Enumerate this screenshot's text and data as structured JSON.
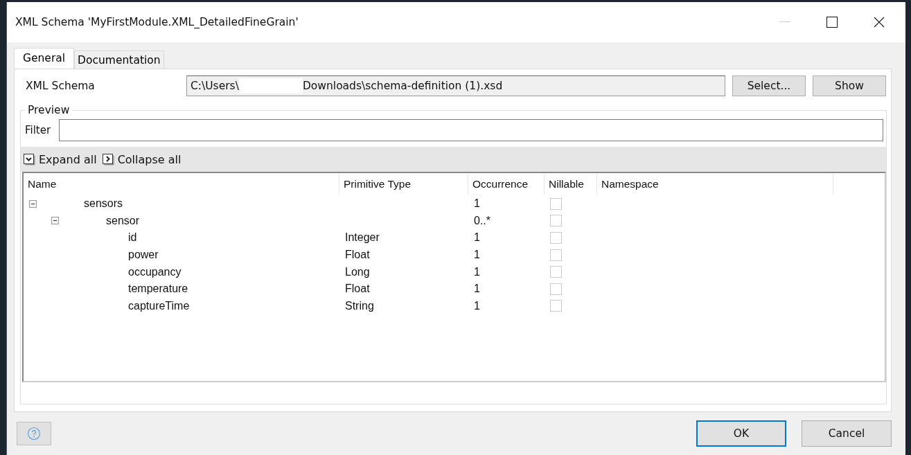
{
  "window": {
    "title": "XML Schema 'MyFirstModule.XML_DetailedFineGrain'"
  },
  "tabs": [
    {
      "label": "General",
      "selected": true
    },
    {
      "label": "Documentation",
      "selected": false
    }
  ],
  "schema": {
    "label": "XML Schema",
    "path_start": "C:\\Users\\",
    "path_end": "Downloads\\schema-definition (1).xsd",
    "buttons": [
      "Select...",
      "Show"
    ]
  },
  "preview": {
    "title": "Preview",
    "filter_label": "Filter",
    "toolbar": [
      {
        "kind": "expand",
        "label": "Expand all"
      },
      {
        "kind": "collapse",
        "label": "Collapse all"
      }
    ],
    "columns": [
      "Name",
      "Primitive Type",
      "Occurrence",
      "Nillable",
      "Namespace"
    ],
    "tree": [
      {
        "name": "sensors",
        "occurrence": "1",
        "nillable": false,
        "expanded": true,
        "children": [
          {
            "name": "sensor",
            "occurrence": "0..*",
            "nillable": false,
            "expanded": true,
            "children": [
              {
                "name": "id",
                "type": "Integer",
                "occurrence": "1",
                "nillable": false
              },
              {
                "name": "power",
                "type": "Float",
                "occurrence": "1",
                "nillable": false
              },
              {
                "name": "occupancy",
                "type": "Long",
                "occurrence": "1",
                "nillable": false
              },
              {
                "name": "temperature",
                "type": "Float",
                "occurrence": "1",
                "nillable": false
              },
              {
                "name": "captureTime",
                "type": "String",
                "occurrence": "1",
                "nillable": false
              }
            ]
          }
        ]
      }
    ]
  },
  "footer": {
    "buttons": [
      {
        "label": "OK",
        "kind": "default"
      },
      {
        "label": "Cancel",
        "kind": "normal"
      }
    ]
  }
}
